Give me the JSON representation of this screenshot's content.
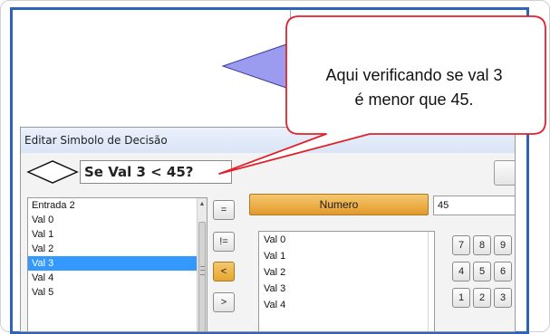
{
  "canvas": {
    "shape_color": "#9b9cf0"
  },
  "dialog": {
    "title": "Editar Simbolo de Decisão",
    "expression": "Se Val 3 < 45?",
    "variables": [
      "Entrada 2",
      "Val 0",
      "Val 1",
      "Val 2",
      "Val 3",
      "Val 4",
      "Val 5"
    ],
    "selected_variable": "Val 3",
    "operators": [
      "=",
      "!=",
      "<",
      ">"
    ],
    "active_operator": "<",
    "numero_label": "Numero",
    "value": "45",
    "targets": [
      "Val 0",
      "Val 1",
      "Val 2",
      "Val 3",
      "Val 4"
    ],
    "keypad": [
      [
        "7",
        "8",
        "9"
      ],
      [
        "4",
        "5",
        "6"
      ],
      [
        "1",
        "2",
        "3"
      ]
    ]
  },
  "callout": {
    "line1": "Aqui verificando se val 3",
    "line2": "é menor que 45.",
    "border_color": "#e0232a"
  },
  "colors": {
    "accent_orange": "#e6a630",
    "selection": "#3399ff",
    "window_border": "#2f63b5"
  }
}
